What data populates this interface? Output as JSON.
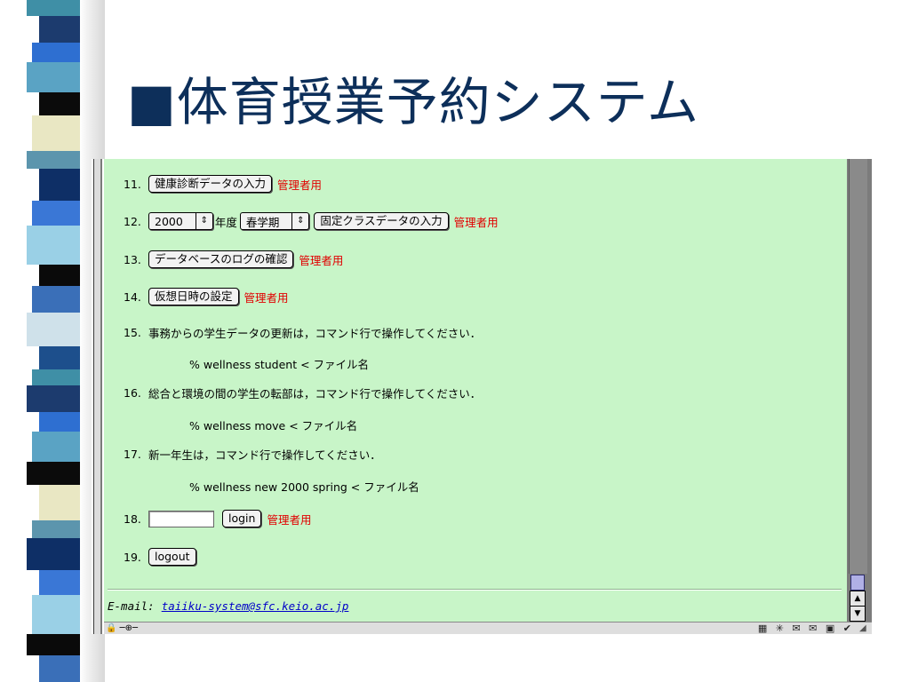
{
  "slide": {
    "title": "■体育授業予約システム"
  },
  "band_colors": [
    "#3f8fa6",
    "#1c3b6e",
    "#2e6fd1",
    "#5aa3c4",
    "#0b0b0b",
    "#e9e7c3",
    "#5c95ad",
    "#0e2f66",
    "#3a77d6",
    "#9ad0e6",
    "#0a0a0a",
    "#3a6fb8",
    "#cfe1ea",
    "#1d4f8c"
  ],
  "browser": {
    "accent_admin": "#e10000",
    "background": "#c8f5c8",
    "items": {
      "i11": {
        "num": "11.",
        "button": "健康診断データの入力",
        "admin": "管理者用"
      },
      "i12": {
        "num": "12.",
        "year": "2000",
        "year_suffix": "年度",
        "term": "春学期",
        "button": "固定クラスデータの入力",
        "admin": "管理者用"
      },
      "i13": {
        "num": "13.",
        "button": "データベースのログの確認",
        "admin": "管理者用"
      },
      "i14": {
        "num": "14.",
        "button": "仮想日時の設定",
        "admin": "管理者用"
      },
      "i15": {
        "num": "15.",
        "text": "事務からの学生データの更新は，コマンド行で操作してください．",
        "cmd": "% wellness student < ファイル名"
      },
      "i16": {
        "num": "16.",
        "text": "総合と環境の間の学生の転部は，コマンド行で操作してください．",
        "cmd": "% wellness move < ファイル名"
      },
      "i17": {
        "num": "17.",
        "text": "新一年生は，コマンド行で操作してください．",
        "cmd": "% wellness new 2000 spring < ファイル名"
      },
      "i18": {
        "num": "18.",
        "input_value": "",
        "button": "login",
        "admin": "管理者用"
      },
      "i19": {
        "num": "19.",
        "button": "logout"
      }
    },
    "footer": {
      "email_label": "E-mail:",
      "email": "taiiku-system@sfc.keio.ac.jp"
    },
    "scrollbar": {
      "up_arrow": "▲",
      "down_arrow": "▼"
    },
    "status_bar": {
      "left": "🔒 ─⊕─",
      "icons": "▦ ✳ ✉ ✉ ▣ ✔"
    }
  }
}
